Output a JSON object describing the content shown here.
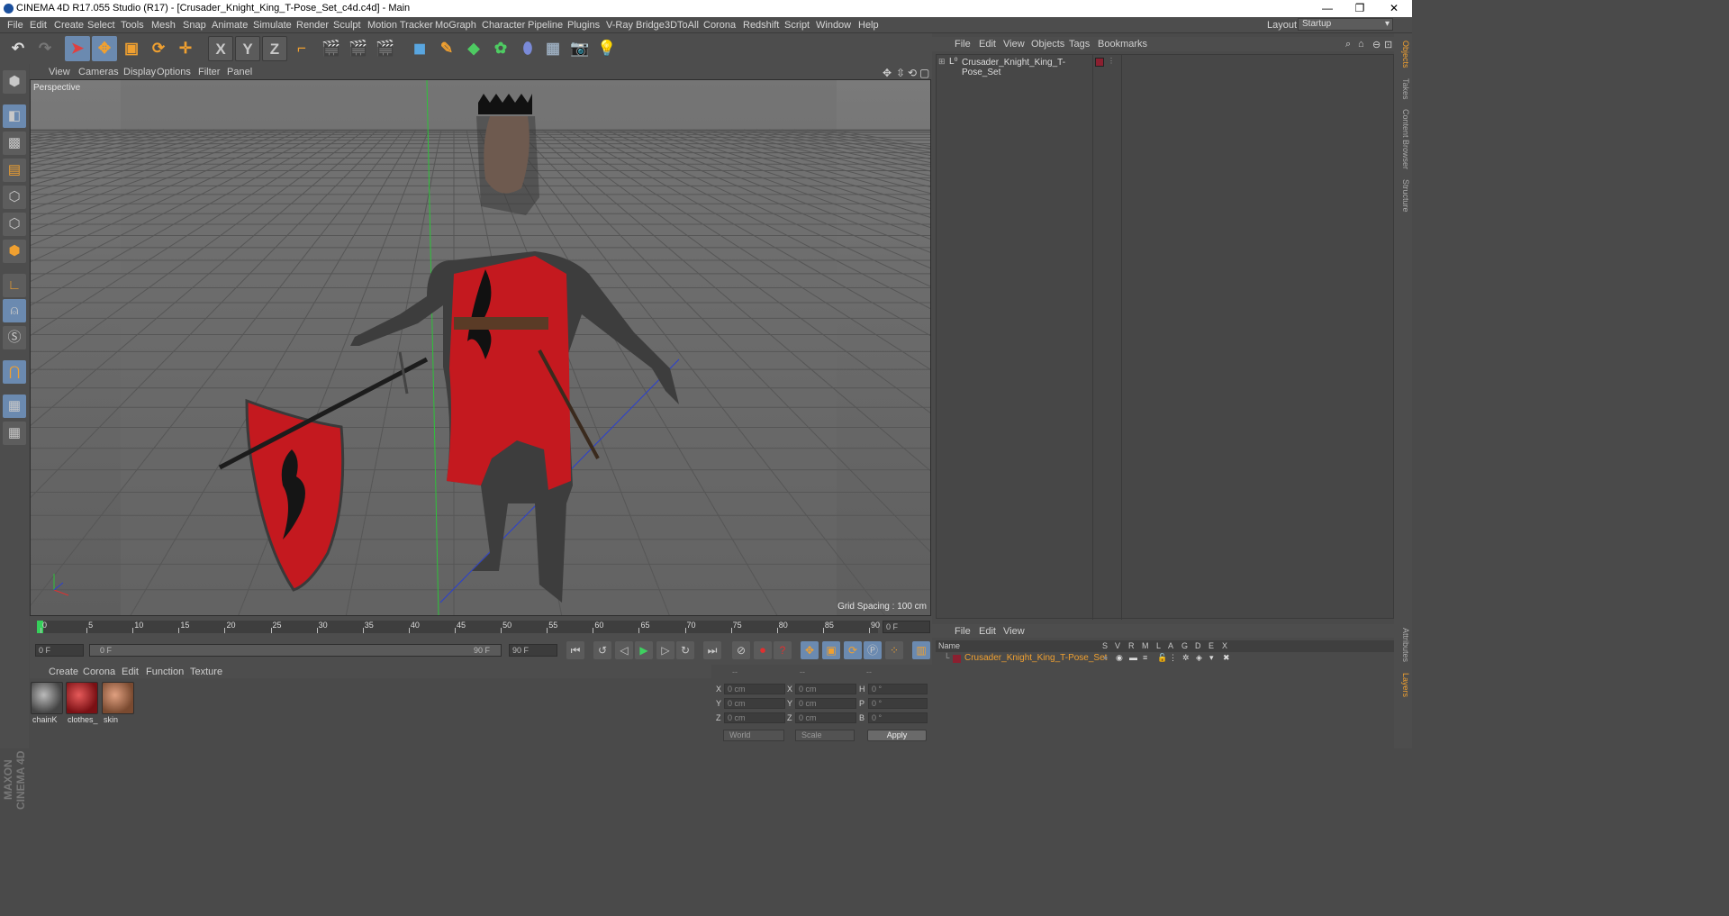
{
  "window": {
    "title": "CINEMA 4D R17.055 Studio (R17) - [Crusader_Knight_King_T-Pose_Set_c4d.c4d] - Main",
    "minimize": "—",
    "restore": "❐",
    "close": "✕"
  },
  "menu": [
    "File",
    "Edit",
    "Create",
    "Select",
    "Tools",
    "Mesh",
    "Snap",
    "Animate",
    "Simulate",
    "Render",
    "Sculpt",
    "Motion Tracker",
    "MoGraph",
    "Character",
    "Pipeline",
    "Plugins",
    "V-Ray Bridge",
    "3DToAll",
    "Corona",
    "Redshift",
    "Script",
    "Window",
    "Help"
  ],
  "layout": {
    "label": "Layout:",
    "value": "Startup"
  },
  "toolbar": {
    "undo": "↶",
    "redo": "↷",
    "x": "X",
    "y": "Y",
    "z": "Z"
  },
  "viewport": {
    "menu": [
      "View",
      "Cameras",
      "Display",
      "Options",
      "Filter",
      "Panel"
    ],
    "camera": "Perspective",
    "grid_spacing": "Grid Spacing : 100 cm"
  },
  "timeline": {
    "ticks": [
      "0",
      "5",
      "10",
      "15",
      "20",
      "25",
      "30",
      "35",
      "40",
      "45",
      "50",
      "55",
      "60",
      "65",
      "70",
      "75",
      "80",
      "85",
      "90"
    ],
    "current_frame": "0 F"
  },
  "transport": {
    "start": "0 F",
    "range_start": "0 F",
    "range_end": "90 F",
    "end": "90 F"
  },
  "materials": {
    "menu": [
      "Create",
      "Corona",
      "Edit",
      "Function",
      "Texture"
    ],
    "items": [
      {
        "name": "chainK",
        "color": "#6e6e6e"
      },
      {
        "name": "clothes_",
        "color": "#a3242a"
      },
      {
        "name": "skin",
        "color": "#b47a5c"
      }
    ]
  },
  "coords": {
    "headers": [
      "--",
      "--",
      "--"
    ],
    "rows": [
      {
        "a": "X",
        "av": "0 cm",
        "b": "X",
        "bv": "0 cm",
        "c": "H",
        "cv": "0 °"
      },
      {
        "a": "Y",
        "av": "0 cm",
        "b": "Y",
        "bv": "0 cm",
        "c": "P",
        "cv": "0 °"
      },
      {
        "a": "Z",
        "av": "0 cm",
        "b": "Z",
        "bv": "0 cm",
        "c": "B",
        "cv": "0 °"
      }
    ],
    "space": "World",
    "mode": "Scale",
    "apply": "Apply"
  },
  "objects": {
    "menu": [
      "File",
      "Edit",
      "View",
      "Objects",
      "Tags",
      "Bookmarks"
    ],
    "tree": [
      {
        "name": "Crusader_Knight_King_T-Pose_Set"
      }
    ]
  },
  "layers": {
    "menu": [
      "File",
      "Edit",
      "View"
    ],
    "columns": [
      "Name",
      "S",
      "V",
      "R",
      "M",
      "L",
      "A",
      "G",
      "D",
      "E",
      "X"
    ],
    "rows": [
      {
        "name": "Crusader_Knight_King_T-Pose_Set"
      }
    ]
  },
  "sidetabs": [
    "Objects",
    "Takes",
    "Content Browser",
    "Structure"
  ],
  "sidetabs_lower": [
    "Attributes",
    "Layers"
  ],
  "brand": "MAXON CINEMA 4D",
  "colors": {
    "accent": "#f0a030",
    "active_tool": "#6b8ab0",
    "layer_swatch": "#8b2030"
  }
}
